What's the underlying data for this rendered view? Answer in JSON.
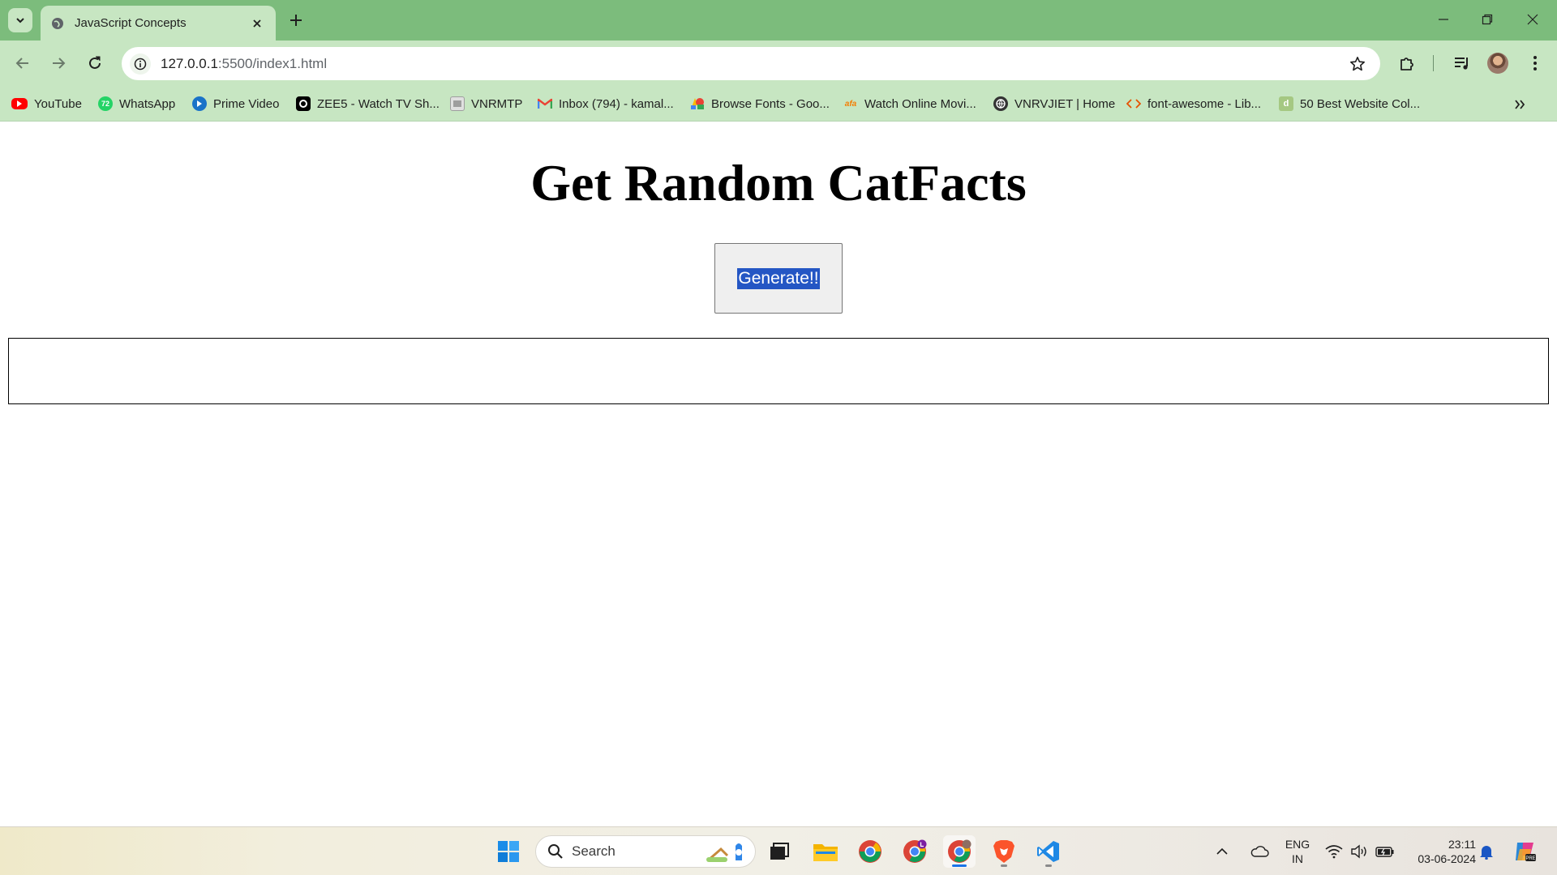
{
  "browser": {
    "tab": {
      "title": "JavaScript Concepts"
    },
    "address": {
      "host": "127.0.0.1",
      "path": ":5500/index1.html"
    },
    "bookmarks": [
      {
        "label": "YouTube",
        "icon": "youtube-icon",
        "color": "#ff0000"
      },
      {
        "label": "WhatsApp",
        "icon": "whatsapp-icon",
        "color": "#25d366",
        "badge": "72"
      },
      {
        "label": "Prime Video",
        "icon": "prime-video-icon",
        "color": "#1a98ff"
      },
      {
        "label": "ZEE5 - Watch TV Sh...",
        "icon": "zee5-icon",
        "color": "#000000"
      },
      {
        "label": "VNRMTP",
        "icon": "vnrmtp-icon",
        "color": "#9e9e9e"
      },
      {
        "label": "Inbox (794) - kamal...",
        "icon": "gmail-icon",
        "color": "#ea4335"
      },
      {
        "label": "Browse Fonts - Goo...",
        "icon": "google-fonts-icon",
        "color": "#4285f4"
      },
      {
        "label": "Watch Online Movi...",
        "icon": "movies-icon",
        "color": "#f57c00"
      },
      {
        "label": "VNRVJIET | Home",
        "icon": "globe-icon",
        "color": "#333333"
      },
      {
        "label": "font-awesome - Lib...",
        "icon": "code-icon",
        "color": "#e65100"
      },
      {
        "label": "50 Best Website Col...",
        "icon": "website-colors-icon",
        "color": "#8bc34a"
      }
    ]
  },
  "page": {
    "heading": "Get Random CatFacts",
    "button_label": "Generate!!",
    "fact_text": ""
  },
  "taskbar": {
    "search_placeholder": "Search",
    "language": "ENG",
    "region": "IN",
    "time": "23:11",
    "date": "03-06-2024"
  }
}
